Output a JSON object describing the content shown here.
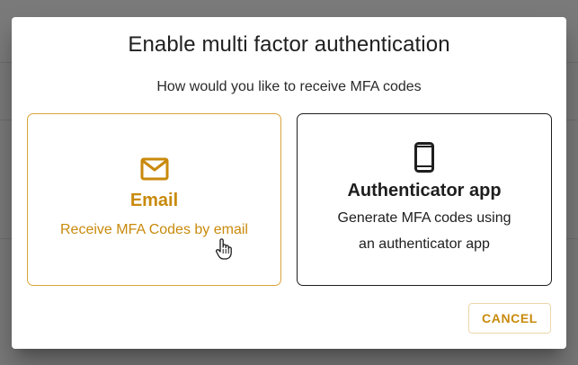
{
  "dialog": {
    "title": "Enable multi factor authentication",
    "subtitle": "How would you like to receive MFA codes",
    "options": [
      {
        "icon": "email-icon",
        "label": "Email",
        "description": "Receive MFA Codes by email",
        "selected": true
      },
      {
        "icon": "smartphone-icon",
        "label": "Authenticator app",
        "description_lines": [
          "Generate MFA codes using",
          "an authenticator app"
        ],
        "selected": false
      }
    ],
    "cancel_label": "CANCEL"
  },
  "colors": {
    "accent": "#c98a0c",
    "accent_border": "#dba43a",
    "overlay": "#7a7a7a",
    "text_dark": "#1f1f1f"
  }
}
